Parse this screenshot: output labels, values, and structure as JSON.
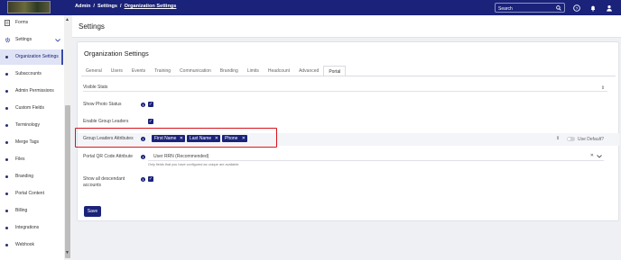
{
  "breadcrumb": {
    "items": [
      "Admin",
      "Settings",
      "Organization Settings"
    ]
  },
  "search": {
    "placeholder": "Search"
  },
  "sidebar": {
    "items": [
      {
        "label": "Forms",
        "icon": "forms-icon"
      },
      {
        "label": "Settings",
        "icon": "gear-icon"
      },
      {
        "label": "Organization Settings",
        "active": true
      },
      {
        "label": "Subaccounts"
      },
      {
        "label": "Admin Permissions"
      },
      {
        "label": "Custom Fields"
      },
      {
        "label": "Terminology"
      },
      {
        "label": "Merge Tags"
      },
      {
        "label": "Files"
      },
      {
        "label": "Branding"
      },
      {
        "label": "Portal Content"
      },
      {
        "label": "Billing"
      },
      {
        "label": "Integrations"
      },
      {
        "label": "Webhook"
      }
    ]
  },
  "page": {
    "title": "Settings"
  },
  "card": {
    "title": "Organization Settings",
    "tabs": [
      "General",
      "Users",
      "Events",
      "Training",
      "Communication",
      "Branding",
      "Limits",
      "Headcount",
      "Advanced",
      "Portal"
    ],
    "active_tab": "Portal",
    "fields": {
      "visible_stats": "Visible Stats",
      "show_photo_status": "Show Photo Status",
      "enable_group_leaders": "Enable Group Leaders",
      "group_leaders_attributes": "Group Leaders Attributes",
      "portal_qr_code_attribute": "Portal QR Code Attribute",
      "show_all_descendant_line1": "Show all descendant",
      "show_all_descendant_line2": "accounts"
    },
    "tags": [
      "First Name",
      "Last Name",
      "Phone"
    ],
    "use_default": "Use Default?",
    "qr_value": "User RRN (Recommended)",
    "qr_help": "Only fields that you have configured as unique are available",
    "save": "Save"
  },
  "colors": {
    "navy": "#1a2279",
    "highlight": "#d8121a"
  }
}
